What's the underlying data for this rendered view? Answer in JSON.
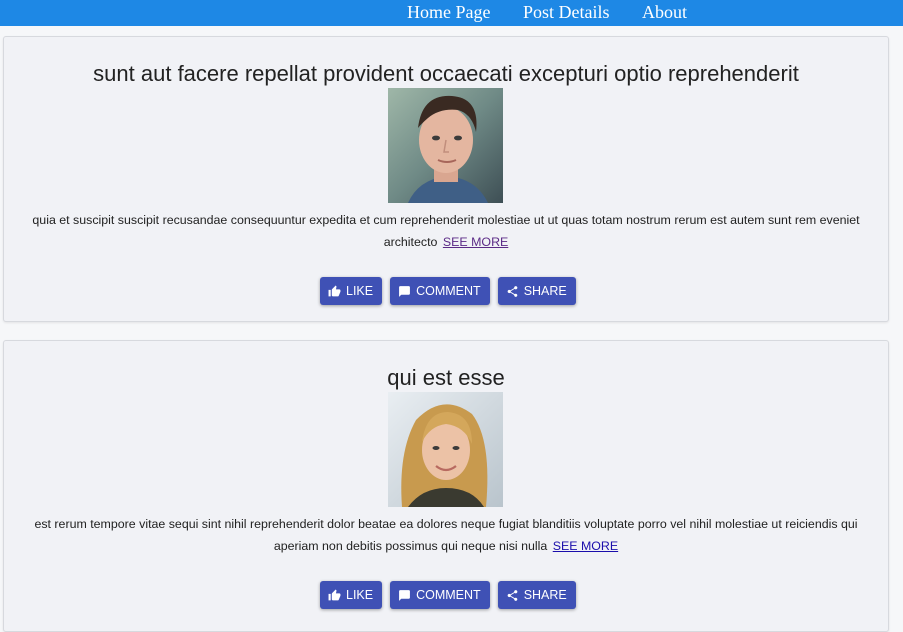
{
  "nav": {
    "items": [
      {
        "label": "Home Page"
      },
      {
        "label": "Post Details"
      },
      {
        "label": "About"
      }
    ],
    "background": "#1e88e5"
  },
  "posts": [
    {
      "title": "sunt aut facere repellat provident occaecati excepturi optio reprehenderit",
      "body": "quia et suscipit suscipit recusandae consequuntur expedita et cum reprehenderit molestiae ut ut quas totam nostrum rerum est autem sunt rem eveniet architecto",
      "see_more": "SEE MORE",
      "avatar": "young man photo"
    },
    {
      "title": "qui est esse",
      "body": "est rerum tempore vitae sequi sint nihil reprehenderit dolor beatae ea dolores neque fugiat blanditiis voluptate porro vel nihil molestiae ut reiciendis qui aperiam non debitis possimus qui neque nisi nulla",
      "see_more": "SEE MORE",
      "avatar": "young woman photo"
    }
  ],
  "actions": {
    "like": "LIKE",
    "comment": "COMMENT",
    "share": "SHARE",
    "icons": {
      "like": "thumb-up-icon",
      "comment": "comment-icon",
      "share": "share-icon"
    },
    "button_color": "#3f51b5"
  }
}
